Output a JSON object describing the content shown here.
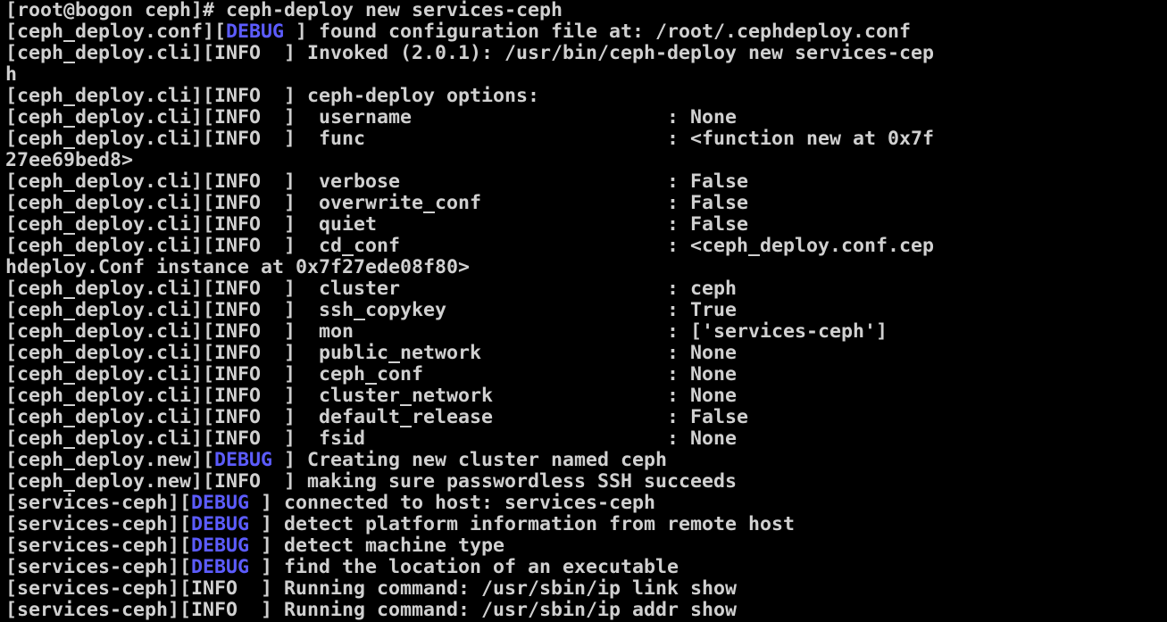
{
  "colors": {
    "background": "#000000",
    "text": "#d0d0d0",
    "debug": "#5c5cff"
  },
  "lines": [
    [
      {
        "t": "[root@bogon ceph]# ceph-deploy new services-ceph"
      }
    ],
    [
      {
        "t": "[ceph_deploy.conf]["
      },
      {
        "t": "DEBUG",
        "c": "debug"
      },
      {
        "t": " ] found configuration file at: /root/.cephdeploy.conf"
      }
    ],
    [
      {
        "t": "[ceph_deploy.cli][INFO  ] Invoked (2.0.1): /usr/bin/ceph-deploy new services-cep"
      }
    ],
    [
      {
        "t": "h"
      }
    ],
    [
      {
        "t": "[ceph_deploy.cli][INFO  ] ceph-deploy options:"
      }
    ],
    [
      {
        "t": "[ceph_deploy.cli][INFO  ]  username                      : None"
      }
    ],
    [
      {
        "t": "[ceph_deploy.cli][INFO  ]  func                          : <function new at 0x7f"
      }
    ],
    [
      {
        "t": "27ee69bed8>"
      }
    ],
    [
      {
        "t": "[ceph_deploy.cli][INFO  ]  verbose                       : False"
      }
    ],
    [
      {
        "t": "[ceph_deploy.cli][INFO  ]  overwrite_conf                : False"
      }
    ],
    [
      {
        "t": "[ceph_deploy.cli][INFO  ]  quiet                         : False"
      }
    ],
    [
      {
        "t": "[ceph_deploy.cli][INFO  ]  cd_conf                       : <ceph_deploy.conf.cep"
      }
    ],
    [
      {
        "t": "hdeploy.Conf instance at 0x7f27ede08f80>"
      }
    ],
    [
      {
        "t": "[ceph_deploy.cli][INFO  ]  cluster                       : ceph"
      }
    ],
    [
      {
        "t": "[ceph_deploy.cli][INFO  ]  ssh_copykey                   : True"
      }
    ],
    [
      {
        "t": "[ceph_deploy.cli][INFO  ]  mon                           : ['services-ceph']"
      }
    ],
    [
      {
        "t": "[ceph_deploy.cli][INFO  ]  public_network                : None"
      }
    ],
    [
      {
        "t": "[ceph_deploy.cli][INFO  ]  ceph_conf                     : None"
      }
    ],
    [
      {
        "t": "[ceph_deploy.cli][INFO  ]  cluster_network               : None"
      }
    ],
    [
      {
        "t": "[ceph_deploy.cli][INFO  ]  default_release               : False"
      }
    ],
    [
      {
        "t": "[ceph_deploy.cli][INFO  ]  fsid                          : None"
      }
    ],
    [
      {
        "t": "[ceph_deploy.new]["
      },
      {
        "t": "DEBUG",
        "c": "debug"
      },
      {
        "t": " ] Creating new cluster named ceph"
      }
    ],
    [
      {
        "t": "[ceph_deploy.new][INFO  ] making sure passwordless SSH succeeds"
      }
    ],
    [
      {
        "t": "[services-ceph]["
      },
      {
        "t": "DEBUG",
        "c": "debug"
      },
      {
        "t": " ] connected to host: services-ceph"
      }
    ],
    [
      {
        "t": "[services-ceph]["
      },
      {
        "t": "DEBUG",
        "c": "debug"
      },
      {
        "t": " ] detect platform information from remote host"
      }
    ],
    [
      {
        "t": "[services-ceph]["
      },
      {
        "t": "DEBUG",
        "c": "debug"
      },
      {
        "t": " ] detect machine type"
      }
    ],
    [
      {
        "t": "[services-ceph]["
      },
      {
        "t": "DEBUG",
        "c": "debug"
      },
      {
        "t": " ] find the location of an executable"
      }
    ],
    [
      {
        "t": "[services-ceph][INFO  ] Running command: /usr/sbin/ip link show"
      }
    ],
    [
      {
        "t": "[services-ceph][INFO  ] Running command: /usr/sbin/ip addr show"
      }
    ]
  ]
}
